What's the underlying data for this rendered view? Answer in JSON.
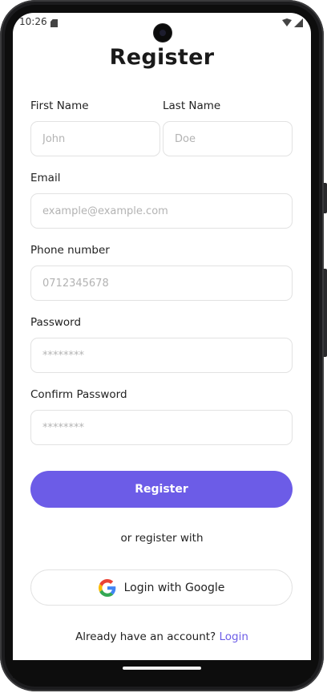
{
  "status_bar": {
    "time": "10:26"
  },
  "title": "Register",
  "form": {
    "first_name": {
      "label": "First Name",
      "placeholder": "John"
    },
    "last_name": {
      "label": "Last Name",
      "placeholder": "Doe"
    },
    "email": {
      "label": "Email",
      "placeholder": "example@example.com"
    },
    "phone": {
      "label": "Phone number",
      "placeholder": "0712345678"
    },
    "password": {
      "label": "Password",
      "placeholder": "********"
    },
    "confirm_password": {
      "label": "Confirm Password",
      "placeholder": "********"
    }
  },
  "register_button": "Register",
  "divider_text": "or register with",
  "google_button": {
    "label": "Login with Google",
    "icon": "google-icon"
  },
  "footer": {
    "prompt": "Already have an account?",
    "link": "Login"
  },
  "colors": {
    "accent": "#6c5ce7",
    "text": "#222222",
    "border": "#e2e2e2"
  }
}
